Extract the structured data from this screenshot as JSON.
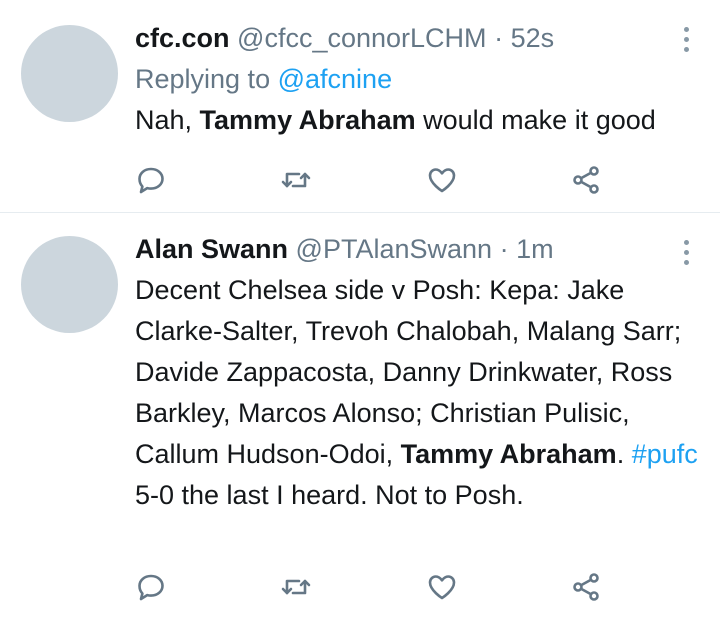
{
  "tweets": [
    {
      "name": "cfc.con",
      "handle": "@cfcc_connorLCHM",
      "dot": "·",
      "time": "52s",
      "replying_prefix": "Replying to",
      "replying_to": "@afcnine",
      "body_pre": "Nah, ",
      "body_bold": "Tammy Abraham",
      "body_post": " would make it good"
    },
    {
      "name": "Alan Swann",
      "handle": "@PTAlanSwann",
      "dot": "·",
      "time": "1m",
      "body_pre": "Decent Chelsea side v Posh: Kepa: Jake Clarke-Salter, Trevoh Chalobah, Malang Sarr; Davide Zappacosta, Danny Drinkwater, Ross Barkley, Marcos Alonso; Christian Pulisic, Callum Hudson-Odoi, ",
      "body_bold": "Tammy Abraham",
      "body_mid": ". ",
      "hashtag": "#pufc",
      "body_post": " 5-0 the last I heard. Not to Posh."
    }
  ],
  "icons": {
    "reply": "reply-icon",
    "retweet": "retweet-icon",
    "like": "heart-icon",
    "share": "share-icon",
    "more": "more-vertical-icon"
  },
  "colors": {
    "icon": "#657786",
    "accent": "#1da1f2",
    "avatar": "#ccd6dd"
  }
}
